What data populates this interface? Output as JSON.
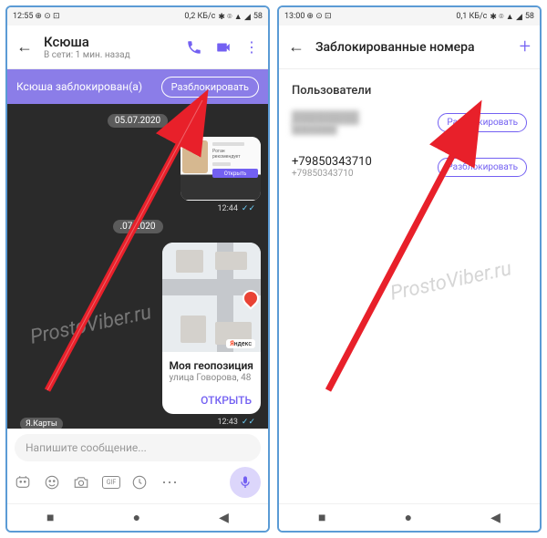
{
  "left": {
    "status": {
      "time": "12:55",
      "speed": "0,2 КБ/с",
      "battery": "58"
    },
    "header": {
      "name": "Ксюша",
      "status": "В сети: 1 мин. назад"
    },
    "banner": {
      "text": "Ксюша заблокирован(а)",
      "button": "Разблокировать"
    },
    "chat": {
      "date1": "05.07.2020",
      "screenshot_msg": {
        "rec_label": "Роган рекомендует",
        "open_btn": "Открыть",
        "time": "12:44"
      },
      "date2": ".07.2020",
      "location": {
        "title": "Моя геопозиция",
        "address": "улица Говорова, 48",
        "open": "ОТКРЫТЬ",
        "yandex": "ндекс",
        "yandex_y": "Я",
        "footer": "Я.Карты",
        "time": "12:43"
      }
    },
    "input": {
      "placeholder": "Напишите сообщение...",
      "gif": "GIF"
    }
  },
  "right": {
    "status": {
      "time": "13:00",
      "speed": "0,1 КБ/с",
      "battery": "58"
    },
    "header": {
      "title": "Заблокированные номера"
    },
    "section": "Пользователи",
    "users": [
      {
        "name": "████████",
        "sub": "███████",
        "button": "Разблокировать"
      },
      {
        "name": "+79850343710",
        "sub": "+79850343710",
        "button": "Разблокировать"
      }
    ]
  },
  "watermark": "ProstoViber.ru"
}
